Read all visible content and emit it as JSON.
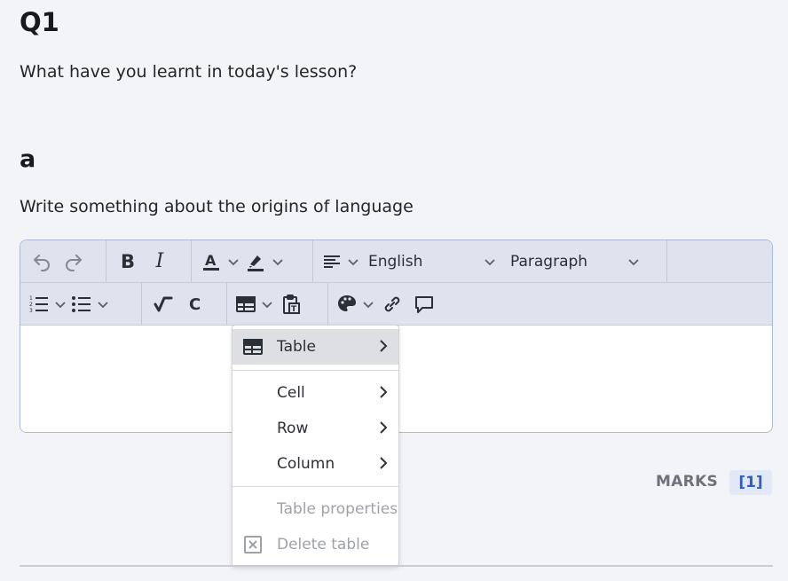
{
  "question": {
    "title": "Q1",
    "text": "What have you learnt in today's lesson?"
  },
  "subquestion": {
    "title": "a",
    "text": "Write something about the origins of language"
  },
  "toolbar": {
    "language_select": "English",
    "block_select": "Paragraph",
    "bold_label": "B",
    "italic_label": "I"
  },
  "table_menu": {
    "items": [
      {
        "label": "Table",
        "icon": "table-icon",
        "submenu": true,
        "active": true
      },
      {
        "label": "Cell",
        "submenu": true
      },
      {
        "label": "Row",
        "submenu": true
      },
      {
        "label": "Column",
        "submenu": true
      },
      {
        "label": "Table properties",
        "disabled": true
      },
      {
        "label": "Delete table",
        "icon": "delete-table-icon",
        "disabled": true
      }
    ]
  },
  "marks": {
    "label": "MARKS",
    "value": "[1]"
  },
  "colors": {
    "accent": "#2f5fc2",
    "toolbar_bg": "#dfe3ed",
    "page_bg": "#f3f4f7"
  }
}
